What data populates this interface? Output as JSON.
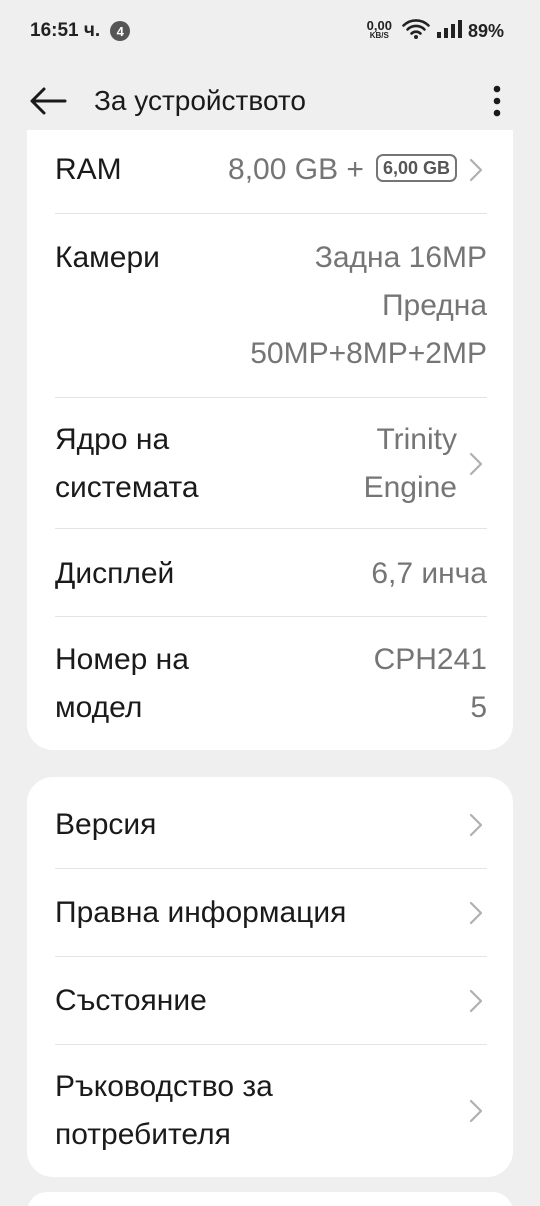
{
  "status_bar": {
    "time": "16:51 ч.",
    "notification_count": "4",
    "net_speed_value": "0,00",
    "net_speed_unit": "KB/S",
    "battery": "89%"
  },
  "header": {
    "title": "За устройството"
  },
  "specs": {
    "ram": {
      "label": "RAM",
      "value": "8,00 GB +",
      "extra": "6,00 GB"
    },
    "cameras": {
      "label": "Камери",
      "line1": "Задна 16MP",
      "line2": "Предна",
      "line3": "50MP+8MP+2MP"
    },
    "kernel": {
      "label1": "Ядро на",
      "label2": "системата",
      "value1": "Trinity",
      "value2": "Engine"
    },
    "display": {
      "label": "Дисплей",
      "value": "6,7 инча"
    },
    "model": {
      "label1": "Номер на",
      "label2": "модел",
      "value1": "CPH241",
      "value2": "5"
    }
  },
  "menu": {
    "version": "Версия",
    "legal": "Правна информация",
    "status": "Състояние",
    "manual1": "Ръководство за",
    "manual2": "потребителя"
  },
  "colors": {
    "background": "#efefef",
    "card": "#ffffff",
    "text": "#1a1a1a",
    "secondary": "#757575"
  }
}
